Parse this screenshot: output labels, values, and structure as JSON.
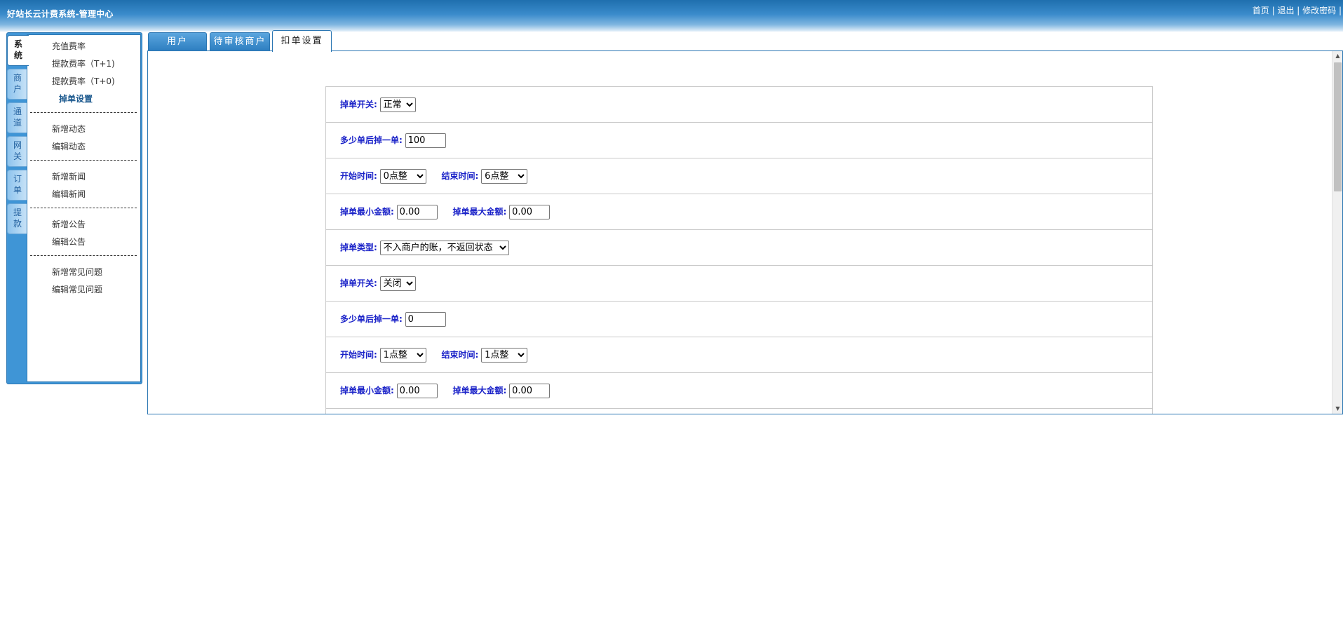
{
  "header": {
    "title": "好站长云计费系统-管理中心",
    "links": [
      "首页",
      "退出",
      "修改密码"
    ],
    "separator": " | "
  },
  "sidebar": {
    "vertical_tabs": [
      "系统",
      "商户",
      "通道",
      "网关",
      "订单",
      "提款"
    ],
    "active_tab": "系统",
    "menu": {
      "rate": "充值费率",
      "withdraw_t1": "提款费率（T+1)",
      "withdraw_t0": "提款费率（T+0)",
      "deduct_settings": "掉单设置",
      "add_news_feed": "新增动态",
      "edit_news_feed": "编辑动态",
      "add_news": "新增新闻",
      "edit_news": "编辑新闻",
      "add_notice": "新增公告",
      "edit_notice": "编辑公告",
      "add_faq": "新增常见问题",
      "edit_faq": "编辑常见问题"
    }
  },
  "tabs": {
    "users": "用户",
    "pending_merchants": "待审核商户",
    "deduct_settings": "扣单设置"
  },
  "form": {
    "labels": {
      "switch": "掉单开关:",
      "after_orders": "多少单后掉一单:",
      "start_time": "开始时间:",
      "end_time": "结束时间:",
      "min_amount": "掉单最小金额:",
      "max_amount": "掉单最大金额:",
      "type": "掉单类型:"
    },
    "group1": {
      "switch_value": "正常",
      "after_orders_value": "100",
      "start_time_value": "0点整",
      "end_time_value": "6点整",
      "min_amount_value": "0.00",
      "max_amount_value": "0.00",
      "type_value": "不入商户的账，不返回状态"
    },
    "group2": {
      "switch_value": "关闭",
      "after_orders_value": "0",
      "start_time_value": "1点整",
      "end_time_value": "1点整",
      "min_amount_value": "0.00",
      "max_amount_value": "0.00"
    }
  },
  "colors": {
    "label_blue": "#1a22c8",
    "header_blue": "#2d7bbd",
    "menu_current": "#1d5a8f"
  }
}
